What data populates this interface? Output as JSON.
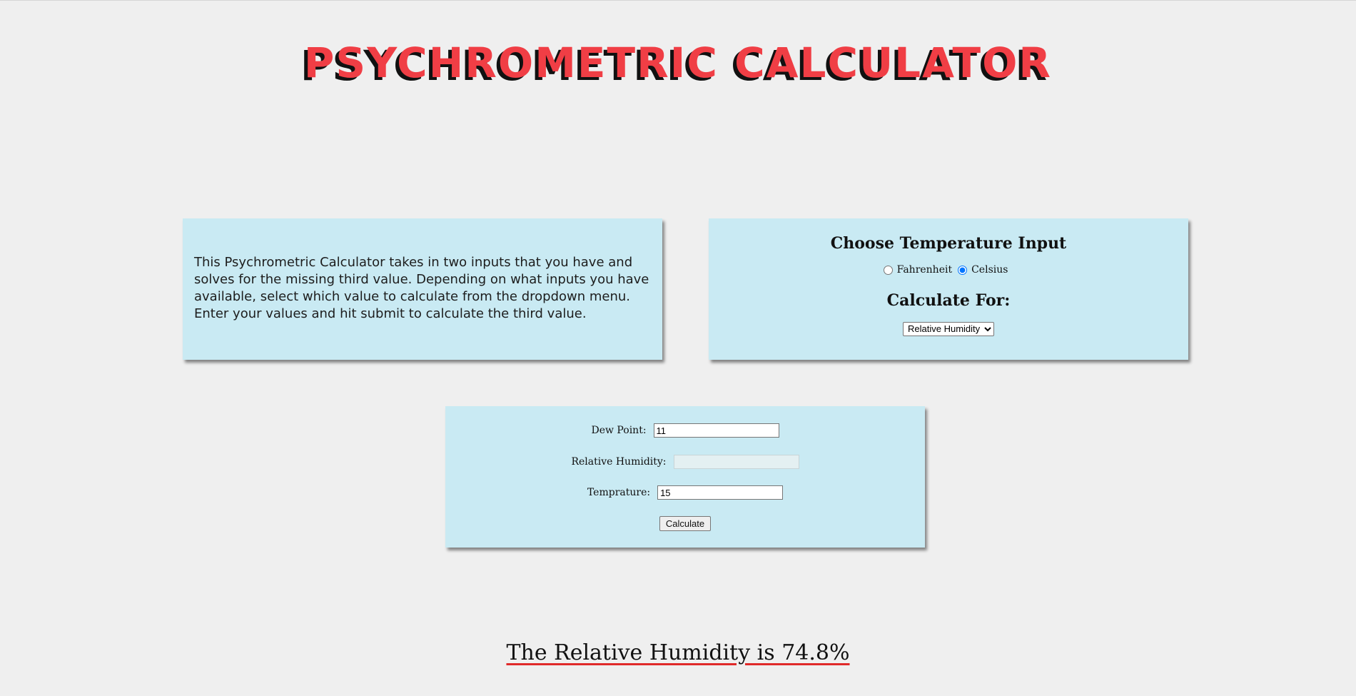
{
  "header": {
    "title": "PSYCHROMETRIC CALCULATOR"
  },
  "info": {
    "description": "This Psychrometric Calculator takes in two inputs that you have and solves for the missing third value. Depending on what inputs you have available, select which value to calculate from the dropdown menu. Enter your values and hit submit to calculate the third value."
  },
  "options": {
    "heading": "Choose Temperature Input",
    "units": [
      {
        "label": "Fahrenheit",
        "checked": false
      },
      {
        "label": "Celsius",
        "checked": true
      }
    ],
    "calc_heading": "Calculate For:",
    "calc_select_value": "Relative Humidity"
  },
  "inputs": {
    "dew_point_label": "Dew Point:",
    "dew_point_value": "11",
    "rh_label": "Relative Humidity:",
    "rh_value": "",
    "temp_label": "Temprature:",
    "temp_value": "15",
    "calculate_label": "Calculate"
  },
  "result": {
    "text": "The Relative Humidity is 74.8%"
  },
  "colors": {
    "background": "#efefef",
    "card": "#c9eaf3",
    "title": "#f03e45",
    "title_shadow": "#111111",
    "underline": "#e02a2a"
  }
}
